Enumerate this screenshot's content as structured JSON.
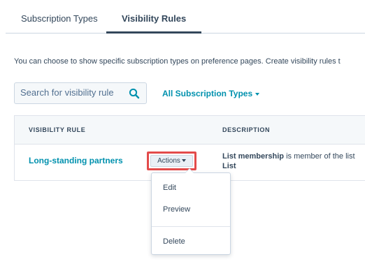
{
  "tabs": [
    {
      "label": "Subscription Types",
      "active": false
    },
    {
      "label": "Visibility Rules",
      "active": true
    }
  ],
  "intro_text": "You can choose to show specific subscription types on preference pages. Create visibility rules t",
  "search": {
    "placeholder": "Search for visibility rule",
    "value": "",
    "icon": "search-icon"
  },
  "filter": {
    "label": "All Subscription Types"
  },
  "table": {
    "columns": [
      "VISIBILITY RULE",
      "DESCRIPTION"
    ],
    "rows": [
      {
        "rule": "Long-standing partners",
        "description_bold": "List membership",
        "description_rest": " is member of the list",
        "description_line2": "List"
      }
    ]
  },
  "actions_button": {
    "label": "Actions"
  },
  "menu": {
    "items": [
      "Edit",
      "Preview",
      "Delete"
    ]
  },
  "colors": {
    "accent": "#0091ae",
    "text": "#33475b",
    "highlight": "#e34b4b",
    "border": "#cbd6e2"
  }
}
